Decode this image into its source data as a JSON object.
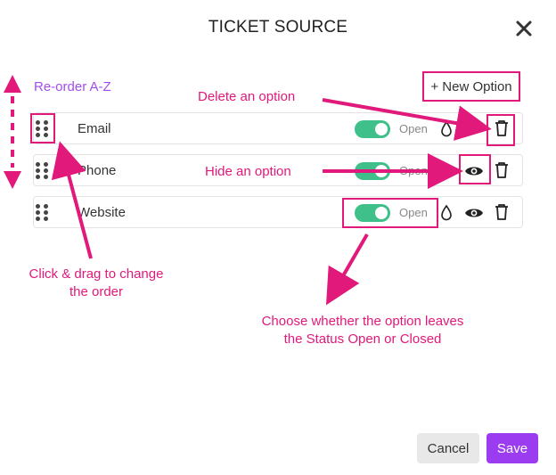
{
  "dialog": {
    "title": "TICKET SOURCE",
    "reorder_label": "Re-order A-Z",
    "new_option_label": "+ New Option",
    "cancel_label": "Cancel",
    "save_label": "Save"
  },
  "options": [
    {
      "name": "Email",
      "status": "Open",
      "enabled": true
    },
    {
      "name": "Phone",
      "status": "Open",
      "enabled": true
    },
    {
      "name": "Website",
      "status": "Open",
      "enabled": true
    }
  ],
  "annotations": {
    "delete": "Delete an option",
    "hide": "Hide an option",
    "drag_line1": "Click & drag to change",
    "drag_line2": "the order",
    "status_line1": "Choose whether the option leaves",
    "status_line2": "the Status Open or Closed"
  },
  "colors": {
    "annotation": "#e0197b",
    "accent_purple": "#9c3cf0",
    "toggle_on": "#3fbf8a"
  },
  "icons": {
    "close": "close-icon",
    "grip": "drag-handle-icon",
    "drop": "droplet-icon",
    "eye": "eye-icon",
    "trash": "trash-icon"
  }
}
